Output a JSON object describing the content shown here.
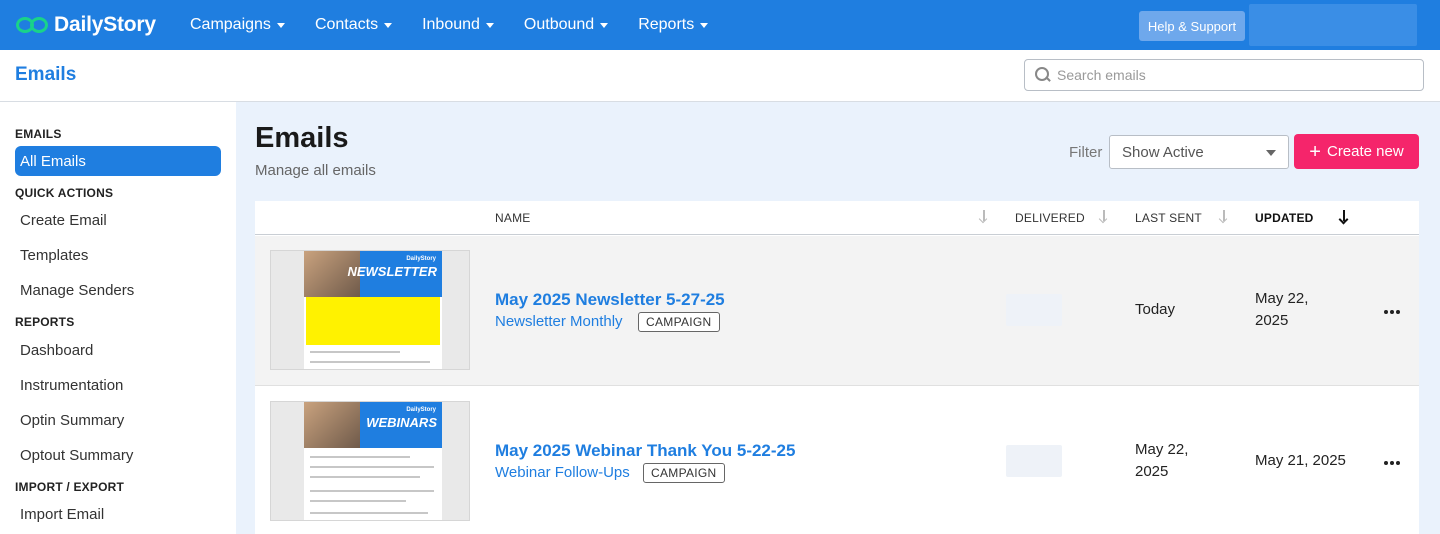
{
  "app": {
    "brand": "DailyStory"
  },
  "topnav": {
    "items": [
      {
        "label": "Campaigns"
      },
      {
        "label": "Contacts"
      },
      {
        "label": "Inbound"
      },
      {
        "label": "Outbound"
      },
      {
        "label": "Reports"
      }
    ],
    "help_label": "Help & Support"
  },
  "subheader": {
    "title": "Emails",
    "search_placeholder": "Search emails"
  },
  "sidebar": {
    "sections": [
      {
        "heading": "EMAILS",
        "items": [
          "All Emails"
        ]
      },
      {
        "heading": "QUICK ACTIONS",
        "items": [
          "Create Email",
          "Templates",
          "Manage Senders"
        ]
      },
      {
        "heading": "REPORTS",
        "items": [
          "Dashboard",
          "Instrumentation",
          "Optin Summary",
          "Optout Summary"
        ]
      },
      {
        "heading": "IMPORT / EXPORT",
        "items": [
          "Import Email"
        ]
      }
    ],
    "active_item": "All Emails"
  },
  "main": {
    "title": "Emails",
    "subtitle": "Manage all emails",
    "filter_label": "Filter",
    "filter_value": "Show Active",
    "create_label": "Create new",
    "columns": [
      "NAME",
      "DELIVERED",
      "LAST SENT",
      "UPDATED"
    ],
    "sorted_column": "UPDATED",
    "rows": [
      {
        "name": "May 2025 Newsletter 5-27-25",
        "list": "Newsletter Monthly",
        "badge": "CAMPAIGN",
        "last_sent": "Today",
        "updated": "May 22, 2025",
        "thumb_brand": "DailyStory",
        "thumb_word": "NEWSLETTER"
      },
      {
        "name": "May 2025 Webinar Thank You 5-22-25",
        "list": "Webinar Follow-Ups",
        "badge": "CAMPAIGN",
        "last_sent": "May 22, 2025",
        "updated": "May 21, 2025",
        "thumb_brand": "DailyStory",
        "thumb_word": "WEBINARS"
      }
    ]
  },
  "colors": {
    "nav_blue": "#1f7ee0",
    "create_pink": "#f5256b",
    "main_bg": "#eaf2fc",
    "logo_green": "#19d38a"
  }
}
